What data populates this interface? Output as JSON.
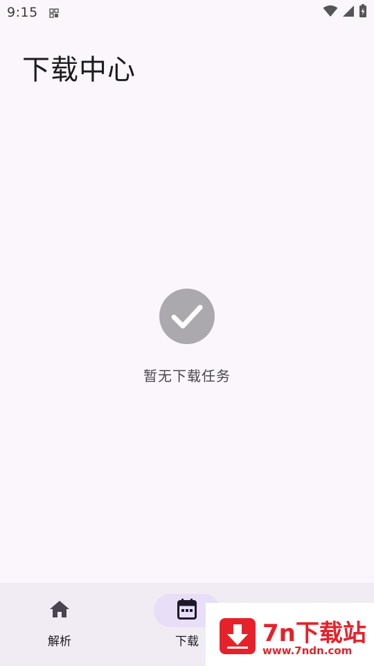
{
  "status_bar": {
    "time": "9:15"
  },
  "header": {
    "title": "下载中心"
  },
  "empty_state": {
    "message": "暂无下载任务",
    "icon": "check-circle-icon"
  },
  "bottom_nav": {
    "items": [
      {
        "label": "解析",
        "icon": "home-icon",
        "selected": false
      },
      {
        "label": "下载",
        "icon": "calendar-icon",
        "selected": true
      }
    ]
  },
  "watermark": {
    "title": "7n下载站",
    "url": "www.7ndn.com"
  },
  "colors": {
    "background": "#FBF6FC",
    "nav_background": "#F1ECF4",
    "nav_selected_pill": "#E8DEF8",
    "empty_icon": "#ABA8AE",
    "watermark_red": "#E62129"
  }
}
